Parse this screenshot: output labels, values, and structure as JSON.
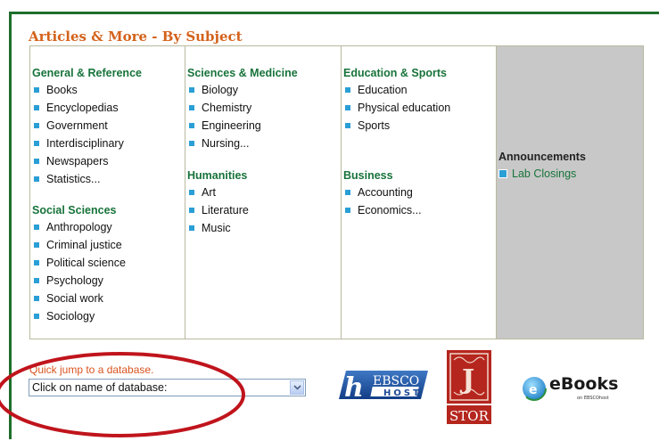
{
  "title": "Articles & More - By Subject",
  "columns": [
    {
      "sections": [
        {
          "heading": "General & Reference",
          "items": [
            "Books",
            "Encyclopedias",
            "Government",
            "Interdisciplinary",
            "Newspapers",
            "Statistics..."
          ]
        },
        {
          "heading": "Social Sciences",
          "items": [
            "Anthropology",
            "Criminal justice",
            "Political science",
            "Psychology",
            "Social work",
            "Sociology"
          ]
        }
      ]
    },
    {
      "sections": [
        {
          "heading": "Sciences & Medicine",
          "items": [
            "Biology",
            "Chemistry",
            "Engineering",
            "Nursing..."
          ]
        },
        {
          "heading": "Humanities",
          "items": [
            "Art",
            "Literature",
            "Music"
          ]
        }
      ]
    },
    {
      "sections": [
        {
          "heading": "Education & Sports",
          "items": [
            "Education",
            "Physical education",
            "Sports"
          ]
        },
        {
          "heading": "Business",
          "items": [
            "Accounting",
            "Economics..."
          ]
        }
      ]
    }
  ],
  "announcements": {
    "heading": "Announcements",
    "items": [
      "Lab Closings"
    ]
  },
  "quick_jump": {
    "label": "Quick jump to a database.",
    "selected": "Click on name of database:"
  },
  "logos": {
    "ebsco": {
      "letter": "h",
      "line1": "EBSCO",
      "line2": "HOST"
    },
    "jstor": {
      "initial": "J",
      "text": "STOR"
    },
    "ebooks": {
      "title": "eBooks",
      "subtitle": "on EBSCOhost"
    }
  },
  "colors": {
    "title": "#d4621c",
    "heading": "#17733a",
    "bullet": "#2a9fd6",
    "frame": "#1f6e2a",
    "highlight_oval": "#c0141c",
    "announce_bg": "#c8c8c8"
  }
}
